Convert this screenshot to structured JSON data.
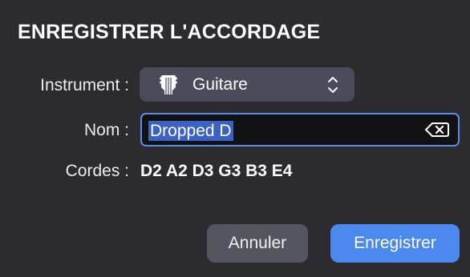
{
  "dialog": {
    "title": "ENREGISTRER L'ACCORDAGE"
  },
  "form": {
    "instrument_label": "Instrument :",
    "instrument_value": "Guitare",
    "instrument_icon": "guitar-icon",
    "name_label": "Nom :",
    "name_value": "Dropped D",
    "strings_label": "Cordes :",
    "strings_value": "D2 A2 D3 G3 B3 E4"
  },
  "actions": {
    "cancel_label": "Annuler",
    "save_label": "Enregistrer"
  },
  "colors": {
    "background": "#2b2b30",
    "select_bg": "#4a4c5b",
    "input_border": "#5c8dea",
    "selection": "#3b62c2",
    "primary_button": "#4a88ee",
    "secondary_button": "#53555f"
  }
}
